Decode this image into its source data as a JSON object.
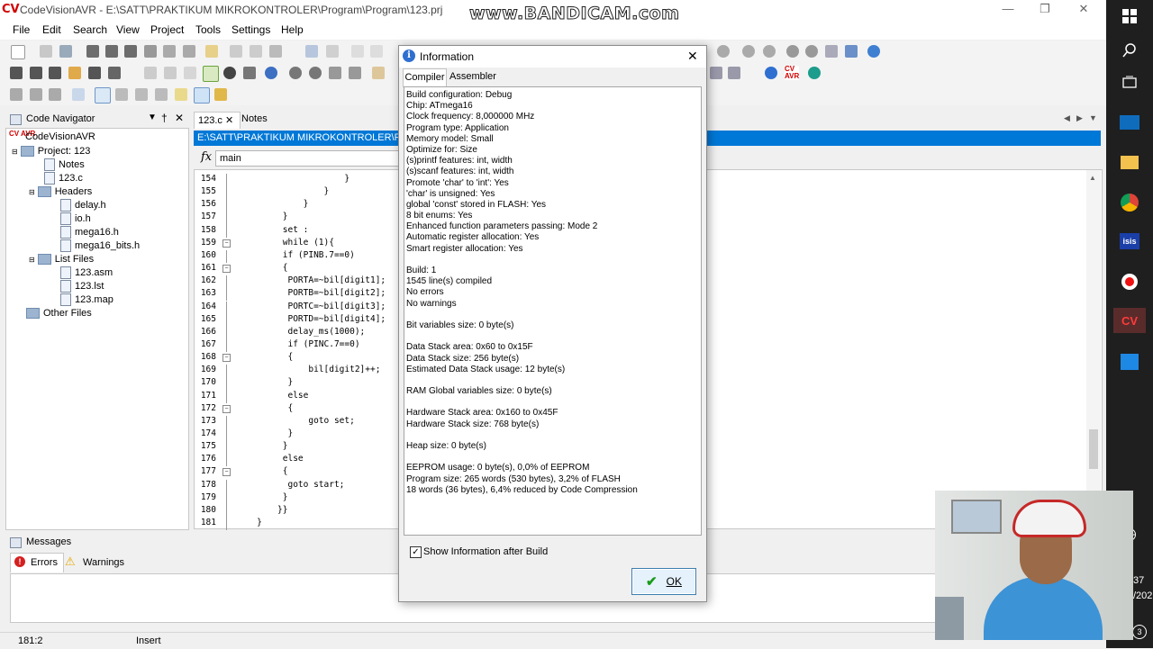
{
  "window": {
    "logo": "CV",
    "title": "CodeVisionAVR - E:\\SATT\\PRAKTIKUM MIKROKONTROLER\\Program\\Program\\123.prj",
    "watermark": "www.BANDICAM.com"
  },
  "menu": [
    "File",
    "Edit",
    "Search",
    "View",
    "Project",
    "Tools",
    "Settings",
    "Help"
  ],
  "navigator": {
    "title": "Code Navigator",
    "tree": [
      {
        "label": "CodeVisionAVR",
        "level": 0,
        "kind": "root"
      },
      {
        "label": "Project: 123",
        "level": 1,
        "kind": "folder"
      },
      {
        "label": "Notes",
        "level": 2,
        "kind": "file"
      },
      {
        "label": "123.c",
        "level": 2,
        "kind": "file"
      },
      {
        "label": "Headers",
        "level": 2,
        "kind": "folder"
      },
      {
        "label": "delay.h",
        "level": 3,
        "kind": "file"
      },
      {
        "label": "io.h",
        "level": 3,
        "kind": "file"
      },
      {
        "label": "mega16.h",
        "level": 3,
        "kind": "file"
      },
      {
        "label": "mega16_bits.h",
        "level": 3,
        "kind": "file"
      },
      {
        "label": "List Files",
        "level": 2,
        "kind": "folder"
      },
      {
        "label": "123.asm",
        "level": 3,
        "kind": "file"
      },
      {
        "label": "123.lst",
        "level": 3,
        "kind": "file"
      },
      {
        "label": "123.map",
        "level": 3,
        "kind": "file"
      },
      {
        "label": "Other Files",
        "level": 1,
        "kind": "folder"
      }
    ]
  },
  "editor": {
    "tabs": [
      "123.c",
      "Notes"
    ],
    "path": "E:\\SATT\\PRAKTIKUM MIKROKONTROLER\\Pro",
    "fx_label": "fx",
    "function_selector": "main",
    "lines": [
      {
        "n": "154",
        "code": "                    }"
      },
      {
        "n": "155",
        "code": "                }"
      },
      {
        "n": "156",
        "code": "            }"
      },
      {
        "n": "157",
        "code": "        }"
      },
      {
        "n": "158",
        "code": "        set :"
      },
      {
        "n": "159",
        "code": "        while (1){"
      },
      {
        "n": "160",
        "code": "        if (PINB.7==0)"
      },
      {
        "n": "161",
        "code": "        {"
      },
      {
        "n": "162",
        "code": "         PORTA=~bil[digit1];"
      },
      {
        "n": "163",
        "code": "         PORTB=~bil[digit2];"
      },
      {
        "n": "164",
        "code": "         PORTC=~bil[digit3];"
      },
      {
        "n": "165",
        "code": "         PORTD=~bil[digit4];"
      },
      {
        "n": "166",
        "code": "         delay_ms(1000);"
      },
      {
        "n": "167",
        "code": "         if (PINC.7==0)"
      },
      {
        "n": "168",
        "code": "         {"
      },
      {
        "n": "169",
        "code": "             bil[digit2]++;"
      },
      {
        "n": "170",
        "code": "         }"
      },
      {
        "n": "171",
        "code": "         else"
      },
      {
        "n": "172",
        "code": "         {"
      },
      {
        "n": "173",
        "code": "             goto set;"
      },
      {
        "n": "174",
        "code": "         }"
      },
      {
        "n": "175",
        "code": "        }"
      },
      {
        "n": "176",
        "code": "        else"
      },
      {
        "n": "177",
        "code": "        {"
      },
      {
        "n": "178",
        "code": "         goto start;"
      },
      {
        "n": "179",
        "code": "        }"
      },
      {
        "n": "180",
        "code": "       }}"
      },
      {
        "n": "181",
        "code": "   }"
      }
    ]
  },
  "messages": {
    "title": "Messages",
    "errors_tab": "Errors",
    "warnings_tab": "Warnings"
  },
  "status": {
    "position": "181:2",
    "mode": "Insert"
  },
  "dialog": {
    "title": "Information",
    "tabs": [
      "Compiler",
      "Assembler"
    ],
    "lines": [
      "Build configuration: Debug",
      "Chip: ATmega16",
      "Clock frequency: 8,000000 MHz",
      "Program type: Application",
      "Memory model: Small",
      "Optimize for: Size",
      "(s)printf features: int, width",
      "(s)scanf features: int, width",
      "Promote 'char' to 'int': Yes",
      "'char' is unsigned: Yes",
      "global 'const' stored in FLASH: Yes",
      "8 bit enums: Yes",
      "Enhanced function parameters passing: Mode 2",
      "Automatic register allocation: Yes",
      "Smart register allocation: Yes",
      "",
      "Build: 1",
      "1545 line(s) compiled",
      "No errors",
      "No warnings",
      "",
      "Bit variables size: 0 byte(s)",
      "",
      "Data Stack area: 0x60 to 0x15F",
      "Data Stack size: 256 byte(s)",
      "Estimated Data Stack usage: 12 byte(s)",
      "",
      "RAM Global variables size: 0 byte(s)",
      "",
      "Hardware Stack area: 0x160 to 0x45F",
      "Hardware Stack size: 768 byte(s)",
      "",
      "Heap size: 0 byte(s)",
      "",
      "EEPROM usage: 0 byte(s), 0,0% of EEPROM",
      "Program size: 265 words (530 bytes), 3,2% of FLASH",
      "18 words (36 bytes), 6,4% reduced by Code Compression"
    ],
    "checkbox_label": "Show Information after Build",
    "checkbox_checked": true,
    "ok_label": "OK"
  },
  "taskbar": {
    "clock_partial": "37",
    "date_partial": "/202",
    "badge": "3"
  },
  "colors": {
    "accent": "#0078d7",
    "brand_red": "#d10000",
    "taskbar": "#1f1f1f"
  }
}
